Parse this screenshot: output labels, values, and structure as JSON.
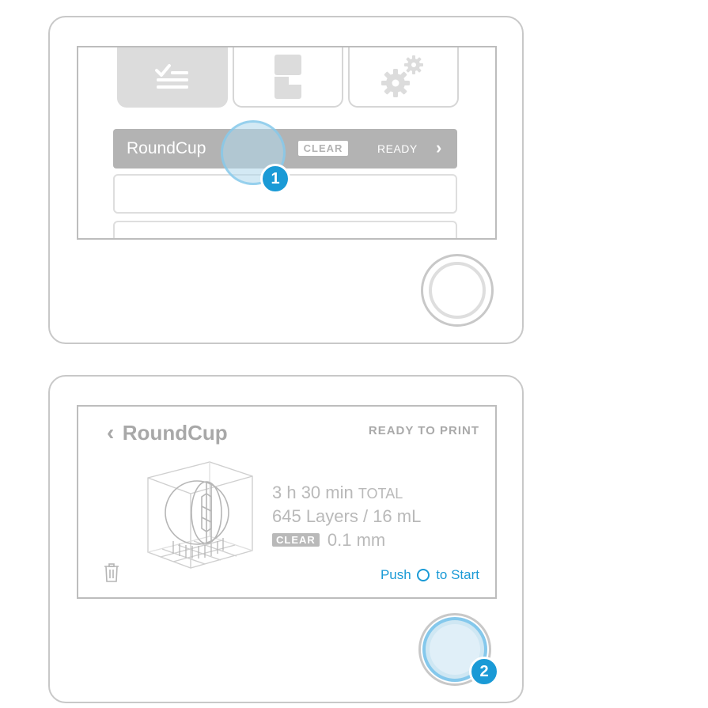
{
  "step1": {
    "tabs": [
      {
        "name": "job-queue-icon",
        "active": true
      },
      {
        "name": "resin-tank-icon",
        "active": false
      },
      {
        "name": "settings-gears-icon",
        "active": false
      }
    ],
    "job_row": {
      "name": "RoundCup",
      "material_badge": "CLEAR",
      "status": "READY",
      "chevron": "›"
    },
    "badge": "1"
  },
  "step2": {
    "back_chevron": "‹",
    "title": "RoundCup",
    "status": "READY TO PRINT",
    "time_value": "3 h 30 min",
    "time_suffix": "TOTAL",
    "layers_volume": "645 Layers / 16 mL",
    "material_badge": "CLEAR",
    "layer_height": "0.1 mm",
    "push_label": "Push",
    "start_label": "to Start",
    "badge": "2"
  },
  "colors": {
    "accent": "#1a9ad6",
    "border": "#c8c8c8",
    "row_selected": "#b3b3b3",
    "text_muted": "#b9b9b9"
  }
}
